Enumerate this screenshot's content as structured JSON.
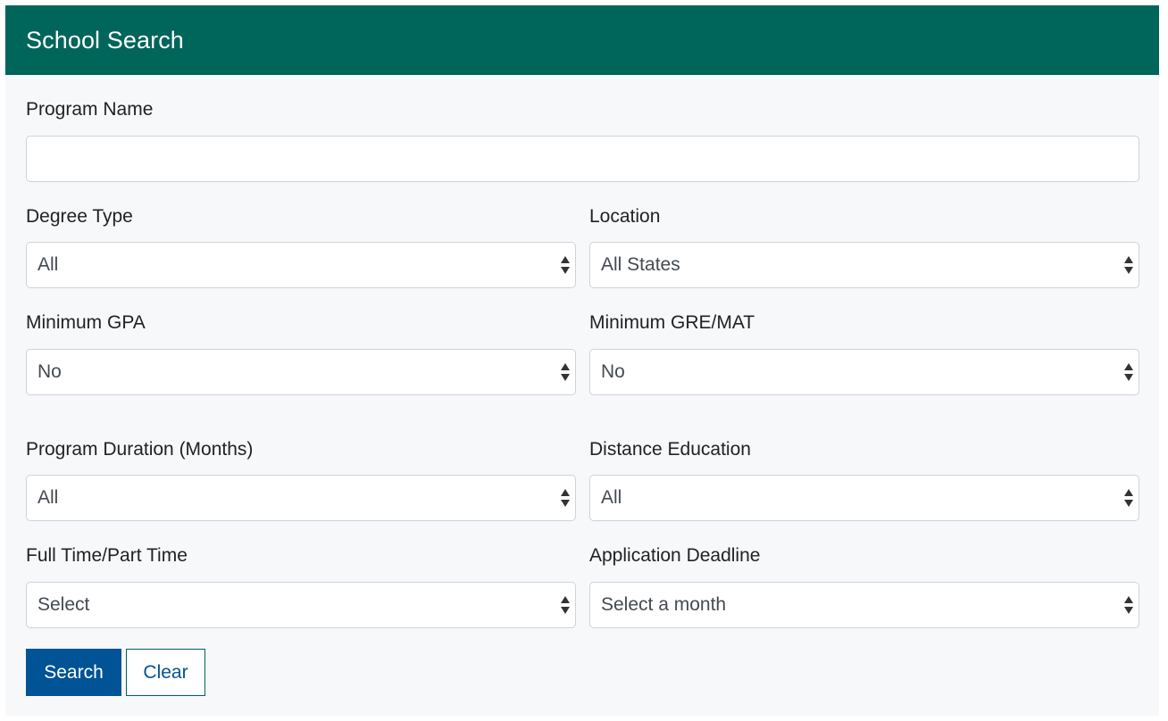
{
  "header": {
    "title": "School Search"
  },
  "form": {
    "program_name": {
      "label": "Program Name",
      "value": "",
      "placeholder": ""
    },
    "degree_type": {
      "label": "Degree Type",
      "selected": "All"
    },
    "location": {
      "label": "Location",
      "selected": "All States"
    },
    "minimum_gpa": {
      "label": "Minimum GPA",
      "selected": "No"
    },
    "minimum_gre_mat": {
      "label": "Minimum GRE/MAT",
      "selected": "No"
    },
    "program_duration": {
      "label": "Program Duration (Months)",
      "selected": "All"
    },
    "distance_education": {
      "label": "Distance Education",
      "selected": "All"
    },
    "full_part_time": {
      "label": "Full Time/Part Time",
      "selected": "Select"
    },
    "application_deadline": {
      "label": "Application Deadline",
      "selected": "Select a month"
    }
  },
  "actions": {
    "search_label": "Search",
    "clear_label": "Clear"
  },
  "icons": {
    "select_arrows": "up-down-arrows-icon"
  },
  "colors": {
    "header_bg": "#00655a",
    "panel_bg": "#f7f8fa",
    "primary_button": "#005394"
  }
}
